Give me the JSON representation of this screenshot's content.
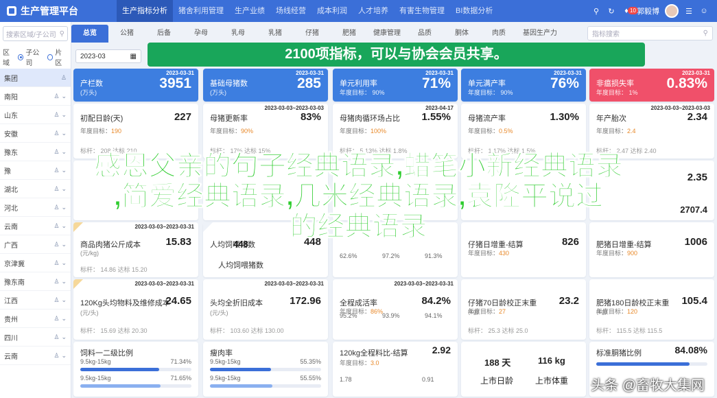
{
  "app": {
    "title": "生产管理平台"
  },
  "nav": [
    "生产指标分析",
    "猪舍利用管理",
    "生产业绩",
    "场线经营",
    "成本利润",
    "人才培养",
    "有害生物管理",
    "BI数据分析"
  ],
  "user": {
    "name": "郭毅博",
    "notifications": "10"
  },
  "sidebar": {
    "search_placeholder": "搜索区域/子公司",
    "radio_options": [
      "区域",
      "子公司",
      "片区"
    ],
    "regions": [
      "集团",
      "南阳",
      "山东",
      "安徽",
      "豫东",
      "豫",
      "湖北",
      "河北",
      "云南",
      "广西",
      "京津冀",
      "豫东南",
      "江西",
      "贵州",
      "四川",
      "云南"
    ]
  },
  "tabs": {
    "items": [
      "总览",
      "公猪",
      "后备",
      "孕母",
      "乳母",
      "乳猪",
      "仔猪",
      "肥猪",
      "健康管理",
      "品质",
      "胴体",
      "肉质",
      "基因生产力"
    ],
    "search_placeholder": "指标搜索"
  },
  "date": "2023-03",
  "banner": "2100项指标，可以与协会会员共享。",
  "row1": [
    {
      "title": "产栏数",
      "unit": "(万头)",
      "value": "3951",
      "date": "2023-03-31",
      "color": "#3d7ee0"
    },
    {
      "title": "基础母猪数",
      "unit": "(万头)",
      "value": "285",
      "date": "2023-03-31",
      "color": "#3d7ee0"
    },
    {
      "title": "单元利用率",
      "unit": "年度目标： 90%",
      "value": "71%",
      "date": "2023-03-31",
      "color": "#3d7ee0"
    },
    {
      "title": "单元满产率",
      "unit": "年度目标： 90%",
      "value": "76%",
      "date": "2023-03-31",
      "color": "#3d7ee0"
    },
    {
      "title": "非瘟损失率",
      "unit": "年度目标： 1%",
      "value": "0.83%",
      "date": "2023-03-31",
      "color": "#f0506a"
    }
  ],
  "row2": [
    {
      "title": "初配日龄(天)",
      "value": "227",
      "target_label": "年度目标：",
      "target": "190",
      "bench": "标杆： 208 达标 210",
      "date": ""
    },
    {
      "title": "母猪更新率",
      "value": "83%",
      "target_label": "年度目标：",
      "target": "90%",
      "bench": "标杆： 17% 达标 15%",
      "date": "2023-03-03~2023-03-03"
    },
    {
      "title": "母猪肉循环场占比",
      "value": "1.55%",
      "target_label": "年度目标：",
      "target": "100%",
      "bench": "标杆： 5.13% 达标 1.8%",
      "date": "2023-04-17"
    },
    {
      "title": "母猪流产率",
      "value": "1.30%",
      "target_label": "年度目标：",
      "target": "0.5%",
      "bench": "标杆： 1.17% 达标 1.5%",
      "date": ""
    },
    {
      "title": "年产胎次",
      "value": "2.34",
      "target_label": "年度目标：",
      "target": "2.4",
      "bench": "标杆： 2.47 达标 2.40",
      "date": "2023-03-03~2023-03-03"
    }
  ],
  "row3_right": [
    "2.35",
    "2707.4"
  ],
  "row4": [
    {
      "title": "商品肉猪公斤成本",
      "unit": "(元/kg)",
      "value": "15.83",
      "bench": "标杆： 14.86 达标 15.20",
      "date": "2023-03-03~2023-03-31"
    },
    {
      "title": "人均饲喂猪数",
      "value": "448"
    },
    {
      "title": "",
      "stats": [
        "62.6%",
        "97.2%",
        "91.3%"
      ],
      "date": ""
    },
    {
      "title": "仔猪日增重-结算",
      "value": "826",
      "target_label": "年度目标：",
      "target": "430",
      "bench": ""
    },
    {
      "title": "肥猪日增重-结算",
      "value": "1006",
      "target_label": "年度目标：",
      "target": "900",
      "bench": ""
    }
  ],
  "row5": [
    {
      "title": "120Kg头均物料及维修成本",
      "unit": "(元/头)",
      "value": "24.65",
      "bench": "标杆： 15.69 达标 20.30",
      "date": "2023-03-03~2023-03-31"
    },
    {
      "title": "头均全折旧成本",
      "unit": "(元/头)",
      "value": "172.96",
      "bench": "标杆： 103.60 达标 130.00",
      "date": "2023-03-03~2023-03-31"
    },
    {
      "title": "全程成活率",
      "value": "84.2%",
      "target_label": "年度目标：",
      "target": "86%",
      "stats": [
        "95.2%",
        "93.9%",
        "94.1%"
      ],
      "date": "2023-03-03~2023-03-31"
    },
    {
      "title": "仔猪70日龄校正末重",
      "unit": "(kg)",
      "value": "23.2",
      "target_label": "年度目标：",
      "target": "27",
      "bench": "标杆： 25.3 达标 25.0"
    },
    {
      "title": "肥猪180日龄校正末重",
      "unit": "(kg)",
      "value": "105.4",
      "target_label": "年度目标：",
      "target": "120",
      "bench": "标杆： 115.5 达标 115.5"
    }
  ],
  "row6": [
    {
      "title": "饲料一二级比例",
      "l1": "9.5kg-15kg",
      "v1": "71.34%",
      "l2": "9.5kg-15kg",
      "v2": "71.65%",
      "p1": 71,
      "p2": 72
    },
    {
      "title": "瘦肉率",
      "l1": "9.5kg-15kg",
      "v1": "55.35%",
      "l2": "9.5kg-15kg",
      "v2": "55.55%",
      "p1": 55,
      "p2": 56
    },
    {
      "title": "120kg全程料比-结算",
      "value": "2.92",
      "target_label": "年度目标：",
      "target": "3.0",
      "a": "1.78",
      "b": "0.91",
      "date": ""
    },
    {
      "title": "",
      "c1": "188 天",
      "c2": "116 kg",
      "c3": "上市日龄",
      "c4": "上市体重"
    },
    {
      "title": "标准胴猪比例",
      "value": "84.08%",
      "p1": 84
    }
  ],
  "overlay": {
    "line1": "感恩父亲的句子经典语录,蜡笔小新经典语录",
    "line2": ",简爱经典语录,几米经典语录,袁隆平说过",
    "line3": "的经典语录"
  },
  "watermark": "头条 @畜牧大集网"
}
